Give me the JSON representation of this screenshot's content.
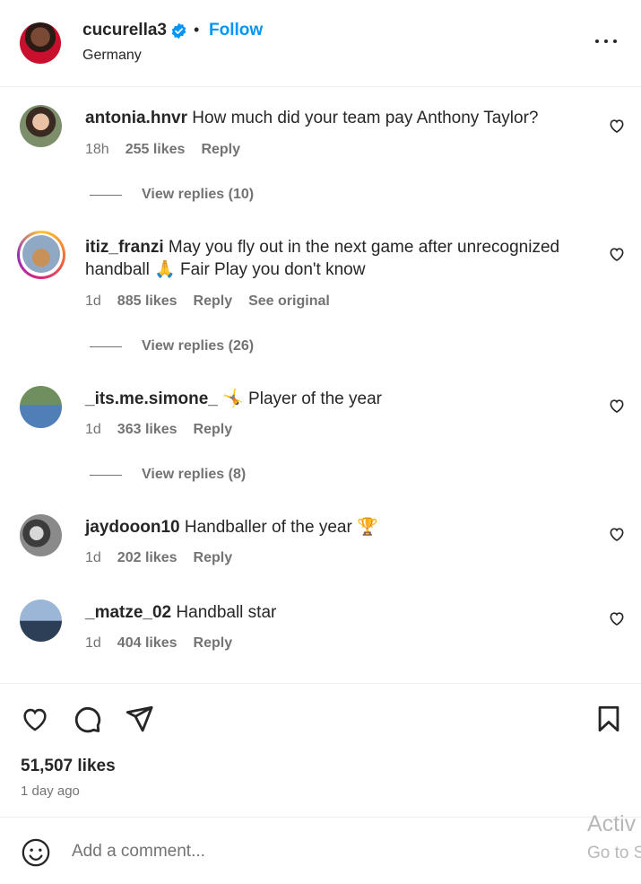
{
  "header": {
    "username": "cucurella3",
    "separator": "•",
    "follow_label": "Follow",
    "location": "Germany"
  },
  "comments": [
    {
      "user": "antonia.hnvr",
      "text": "How much did your team pay Anthony Taylor?",
      "time": "18h",
      "likes": "255 likes",
      "reply": "Reply",
      "view_replies": "View replies (10)"
    },
    {
      "user": "itiz_franzi",
      "text": "May you fly out in the next game after unrecognized handball 🙏 Fair Play you don't know",
      "time": "1d",
      "likes": "885 likes",
      "reply": "Reply",
      "see_original": "See original",
      "view_replies": "View replies (26)"
    },
    {
      "user": "_its.me.simone_",
      "text": "🤸 Player of the year",
      "time": "1d",
      "likes": "363 likes",
      "reply": "Reply",
      "view_replies": "View replies (8)"
    },
    {
      "user": "jaydooon10",
      "text": "Handballer of the year 🏆",
      "time": "1d",
      "likes": "202 likes",
      "reply": "Reply"
    },
    {
      "user": "_matze_02",
      "text": "Handball star",
      "time": "1d",
      "likes": "404 likes",
      "reply": "Reply"
    }
  ],
  "post": {
    "likes": "51,507 likes",
    "time": "1 day ago"
  },
  "comment_bar": {
    "placeholder": "Add a comment..."
  },
  "watermark": {
    "line1": "Activ",
    "line2": "Go to S"
  },
  "icons": {
    "verified": "verified-badge-icon",
    "more": "more-options-icon",
    "heart": "heart-icon",
    "comment": "comment-icon",
    "share": "share-icon",
    "save": "bookmark-icon",
    "emoji": "emoji-icon"
  },
  "colors": {
    "accent": "#0095f6",
    "text": "#262626",
    "secondary": "#737373"
  }
}
